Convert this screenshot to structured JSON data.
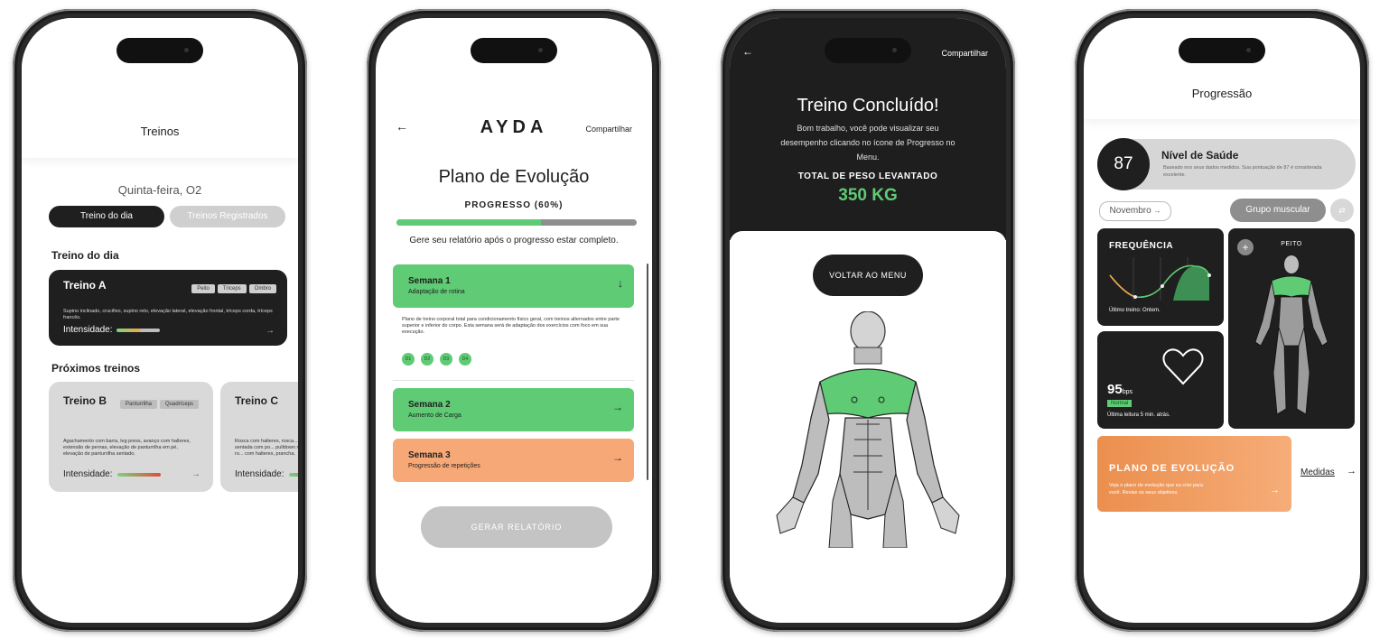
{
  "screen1": {
    "title": "Treinos",
    "date": "Quinta-feira, O2",
    "tab_today": "Treino do dia",
    "tab_registered": "Treinos Registrados",
    "section_today": "Treino do dia",
    "section_next": "Próximos treinos",
    "card_a": {
      "name": "Treino A",
      "tags": [
        "Peito",
        "Tríceps",
        "Ombro"
      ],
      "description": "Supino inclinado, crucifixo, supino reto, elevação lateral, elevação frontal, tríceps corda, tríceps francês.",
      "intensity_label": "Intensidade:"
    },
    "card_b": {
      "name": "Treino B",
      "tags": [
        "Panturrilha",
        "Quadríceps"
      ],
      "description": "Agachamento com barra, leg press, avanço com halteres, extensão de pernas, elevação de panturrilha em pé, elevação de panturrilha sentado.",
      "intensity_label": "Intensidade:"
    },
    "card_c": {
      "name": "Treino C",
      "description": "Rosca com halteres, rosca... remada sentada com po... pulldown na polia alta, ro... com halteres, prancha.",
      "intensity_label": "Intensidade:"
    },
    "arrow": "→"
  },
  "screen2": {
    "back": "←",
    "logo": "AYDA",
    "share": "Compartilhar",
    "title": "Plano de Evolução",
    "progress_label": "PROGRESSO (60%)",
    "progress_value": 0.6,
    "subtitle": "Gere seu relatório após o progresso estar completo.",
    "weeks": [
      {
        "title": "Semana 1",
        "sub": "Adaptação de rotina",
        "arrow": "↓"
      },
      {
        "title": "Semana 2",
        "sub": "Aumento de Carga",
        "arrow": "→"
      },
      {
        "title": "Semana 3",
        "sub": "Progressão de repetições",
        "arrow": "→"
      }
    ],
    "week1_detail": "Plano de treino corporal total para condicionamento físico geral, com treinos alternados entre parte superior e inferior do corpo. Esta semana será de adaptação dos exercícios com foco em sua execução.",
    "days": [
      "D1",
      "D2",
      "D3",
      "D4"
    ],
    "button": "GERAR RELATÓRIO",
    "colors": {
      "green": "#5fcb74",
      "orange": "#f7a877"
    }
  },
  "screen3": {
    "back": "←",
    "share": "Compartilhar",
    "title": "Treino Concluído!",
    "message": "Bom trabalho, você pode visualizar seu desempenho clicando no ícone de Progresso no Menu.",
    "total_label": "TOTAL DE PESO LEVANTADO",
    "total_value": "350 KG",
    "button": "VOLTAR AO MENU"
  },
  "screen4": {
    "title": "Progressão",
    "score": "87",
    "health_title": "Nível de Saúde",
    "health_text": "Baseado nos seus dados medidos. Sua pontuação de 87 é considerada excelente.",
    "month": "Novembro",
    "month_arrow": "→",
    "muscle_group": "Grupo muscular",
    "frequency": "FREQUÊNCIA",
    "last_workout": "Último treino: Ontem.",
    "bpm_value": "95",
    "bpm_unit": "bps",
    "bpm_status": "Normal",
    "last_reading": "Última leitura 5 min. atrás.",
    "muscle_label": "PEITO",
    "plus": "+",
    "plan_title": "PLANO DE EVOLUÇÃO",
    "plan_text": "Veja o plano de evolução que eu criei para você. Revise os seus objetivos.",
    "plan_arrow": "→",
    "measures": "Medidas",
    "measures_arrow": "→"
  }
}
